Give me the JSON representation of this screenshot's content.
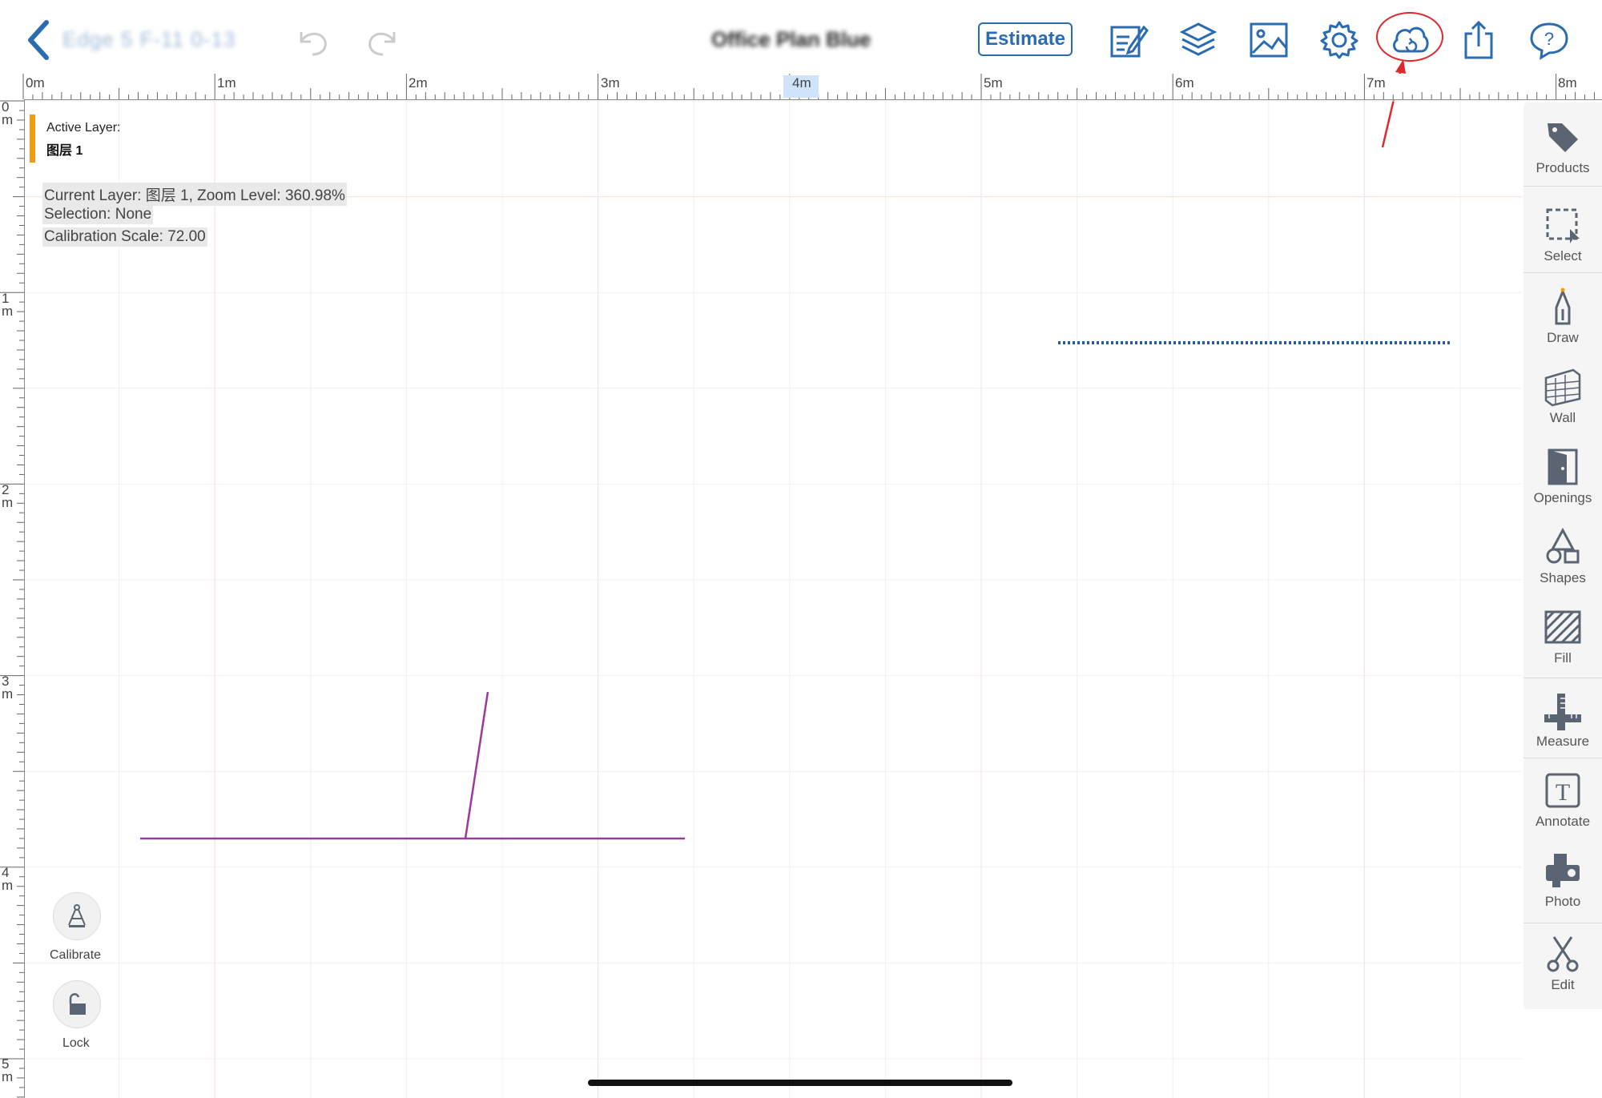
{
  "toolbar": {
    "back_title": "Edge 5 F-11 0-13",
    "document_title": "Office Plan Blue",
    "estimate_label": "Estimate",
    "icons": [
      "undo-icon",
      "redo-icon",
      "edit-icon",
      "layers-icon",
      "image-icon",
      "settings-icon",
      "cloud-sync-icon",
      "share-icon",
      "help-icon"
    ]
  },
  "ruler": {
    "top_labels": [
      "0m",
      "1m",
      "2m",
      "3m",
      "4m",
      "5m",
      "6m",
      "7m",
      "8m"
    ],
    "left_labels": [
      {
        "num": "0",
        "unit": "m"
      },
      {
        "num": "1",
        "unit": "m"
      },
      {
        "num": "2",
        "unit": "m"
      },
      {
        "num": "3",
        "unit": "m"
      },
      {
        "num": "4",
        "unit": "m"
      },
      {
        "num": "5",
        "unit": "m"
      }
    ]
  },
  "info": {
    "active_layer_label": "Active Layer:",
    "active_layer_name": "图层 1",
    "current_layer_line": "Current Layer: 图层 1, Zoom Level: 360.98%",
    "selection_line": "Selection: None",
    "calibration_line": "Calibration Scale: 72.00"
  },
  "tools": [
    {
      "label": "Products",
      "icon": "tag-icon"
    },
    {
      "label": "Select",
      "icon": "select-icon"
    },
    {
      "label": "Draw",
      "icon": "pen-icon"
    },
    {
      "label": "Wall",
      "icon": "wall-icon"
    },
    {
      "label": "Openings",
      "icon": "door-icon"
    },
    {
      "label": "Shapes",
      "icon": "shapes-icon"
    },
    {
      "label": "Fill",
      "icon": "fill-icon"
    },
    {
      "label": "Measure",
      "icon": "measure-icon"
    },
    {
      "label": "Annotate",
      "icon": "text-icon"
    },
    {
      "label": "Photo",
      "icon": "camera-icon"
    },
    {
      "label": "Edit",
      "icon": "scissors-icon"
    }
  ],
  "bottom_left": {
    "calibrate_label": "Calibrate",
    "lock_label": "Lock"
  },
  "colors": {
    "accent": "#2b6cb0",
    "layer_bar": "#f59a0e",
    "wall_line": "#9b3a9c",
    "dotted_line": "#1e5fa8",
    "highlight": "#e0272b"
  }
}
